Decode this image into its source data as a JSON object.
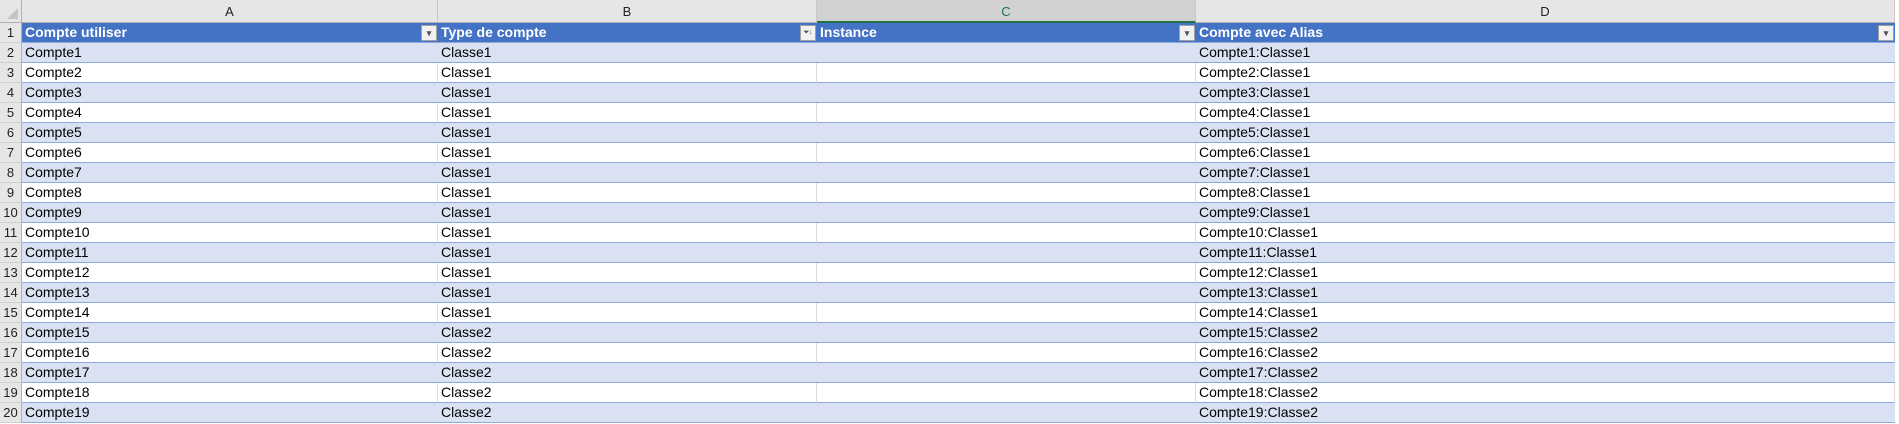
{
  "columns": [
    "A",
    "B",
    "C",
    "D"
  ],
  "selected_column": "C",
  "headers": [
    "Compte utiliser",
    "Type de compte",
    "Instance",
    "Compte avec Alias"
  ],
  "filter_icons": [
    "filter-dropdown-icon",
    "sort-filter-icon",
    "filter-dropdown-icon",
    "filter-dropdown-icon"
  ],
  "rows": [
    [
      "Compte1",
      "Classe1",
      "",
      "Compte1:Classe1"
    ],
    [
      "Compte2",
      "Classe1",
      "",
      "Compte2:Classe1"
    ],
    [
      "Compte3",
      "Classe1",
      "",
      "Compte3:Classe1"
    ],
    [
      "Compte4",
      "Classe1",
      "",
      "Compte4:Classe1"
    ],
    [
      "Compte5",
      "Classe1",
      "",
      "Compte5:Classe1"
    ],
    [
      "Compte6",
      "Classe1",
      "",
      "Compte6:Classe1"
    ],
    [
      "Compte7",
      "Classe1",
      "",
      "Compte7:Classe1"
    ],
    [
      "Compte8",
      "Classe1",
      "",
      "Compte8:Classe1"
    ],
    [
      "Compte9",
      "Classe1",
      "",
      "Compte9:Classe1"
    ],
    [
      "Compte10",
      "Classe1",
      "",
      "Compte10:Classe1"
    ],
    [
      "Compte11",
      "Classe1",
      "",
      "Compte11:Classe1"
    ],
    [
      "Compte12",
      "Classe1",
      "",
      "Compte12:Classe1"
    ],
    [
      "Compte13",
      "Classe1",
      "",
      "Compte13:Classe1"
    ],
    [
      "Compte14",
      "Classe1",
      "",
      "Compte14:Classe1"
    ],
    [
      "Compte15",
      "Classe2",
      "",
      "Compte15:Classe2"
    ],
    [
      "Compte16",
      "Classe2",
      "",
      "Compte16:Classe2"
    ],
    [
      "Compte17",
      "Classe2",
      "",
      "Compte17:Classe2"
    ],
    [
      "Compte18",
      "Classe2",
      "",
      "Compte18:Classe2"
    ],
    [
      "Compte19",
      "Classe2",
      "",
      "Compte19:Classe2"
    ]
  ],
  "row_numbers": [
    "1",
    "2",
    "3",
    "4",
    "5",
    "6",
    "7",
    "8",
    "9",
    "10",
    "11",
    "12",
    "13",
    "14",
    "15",
    "16",
    "17",
    "18",
    "19",
    "20"
  ]
}
